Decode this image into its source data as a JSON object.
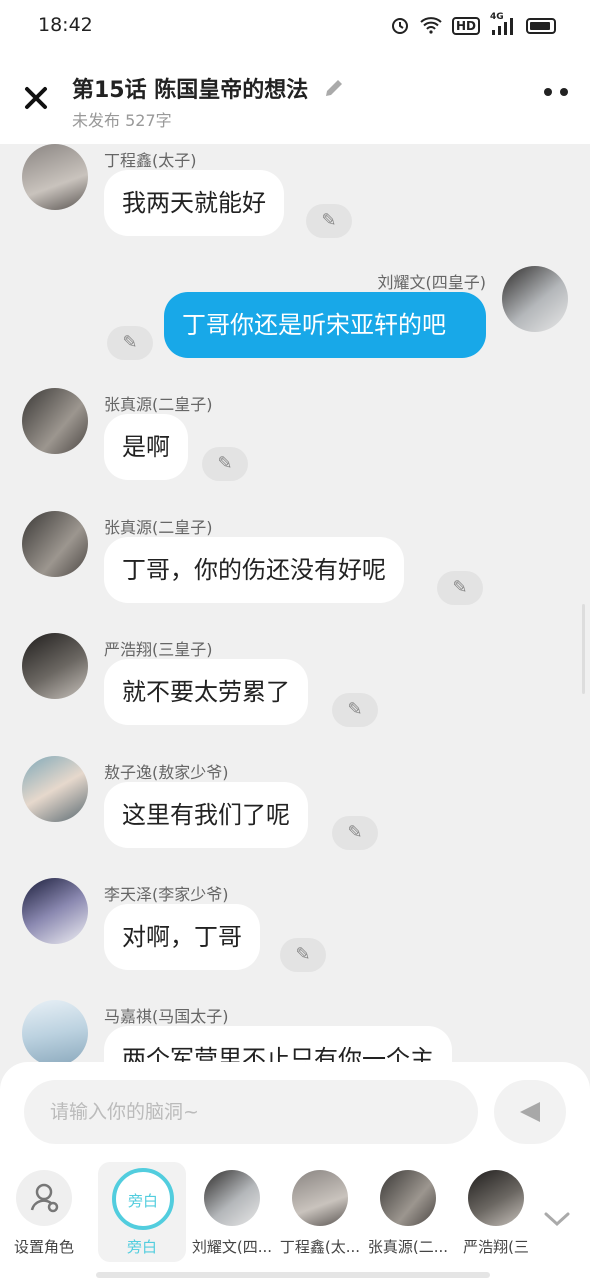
{
  "status_bar": {
    "time": "18:42",
    "icons": [
      "alarm-icon",
      "wifi-icon",
      "hd-icon",
      "signal-4g-icon",
      "battery-icon"
    ],
    "hd": "HD",
    "net": "4G"
  },
  "header": {
    "title": "第15话  陈国皇帝的想法",
    "subtitle": "未发布 527字"
  },
  "messages": [
    {
      "speaker": "丁程鑫(太子)",
      "text": "我两天就能好",
      "side": "left"
    },
    {
      "speaker": "刘耀文(四皇子)",
      "text": "丁哥你还是听宋亚轩的吧",
      "side": "right"
    },
    {
      "speaker": "张真源(二皇子)",
      "text": "是啊",
      "side": "left"
    },
    {
      "speaker": "张真源(二皇子)",
      "text": "丁哥，你的伤还没有好呢",
      "side": "left"
    },
    {
      "speaker": "严浩翔(三皇子)",
      "text": "就不要太劳累了",
      "side": "left"
    },
    {
      "speaker": "敖子逸(敖家少爷)",
      "text": "这里有我们了呢",
      "side": "left"
    },
    {
      "speaker": "李天泽(李家少爷)",
      "text": "对啊，丁哥",
      "side": "left"
    },
    {
      "speaker": "马嘉祺(马国太子)",
      "text": "两个军营里不止只有你一个主",
      "side": "left"
    }
  ],
  "composer": {
    "placeholder": "请输入你的脑洞~"
  },
  "roles": [
    {
      "label": "设置角色"
    },
    {
      "label": "旁白",
      "ring_text": "旁白"
    },
    {
      "label": "刘耀文(四..."
    },
    {
      "label": "丁程鑫(太..."
    },
    {
      "label": "张真源(二..."
    },
    {
      "label": "严浩翔(三"
    }
  ],
  "colors": {
    "accent": "#18a8e8",
    "narrator": "#52cdde",
    "background": "#f0f0f0"
  }
}
